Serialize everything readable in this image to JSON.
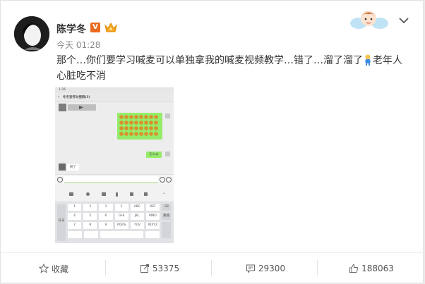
{
  "user": {
    "name": "陈学冬",
    "verified_badge": "V",
    "time": "今天 01:28"
  },
  "post": {
    "text_part1": "那个…你们要学习喊麦可以单独拿我的喊麦视频教学…错了…溜了溜了",
    "text_part2": "老年人心脏吃不消"
  },
  "screenshot": {
    "status_time": "1:26",
    "chat_title": "冬冬宣传对接群(5)",
    "msg_right": "怎么办",
    "msg_left": "刷了",
    "keys_row1": [
      "1",
      "2",
      "3",
      "1",
      "ABC",
      "DEF",
      "⌫"
    ],
    "keys_row2": [
      "4",
      "5",
      "6",
      "GHI",
      "JKL",
      "MNO"
    ],
    "keys_row3": [
      "7",
      "8",
      "9",
      "PQRS",
      "TUV",
      "WXYZ"
    ],
    "key_right2": "重输",
    "key_left": "符号"
  },
  "actions": {
    "favorite_label": "收藏",
    "repost_count": "53375",
    "comment_count": "29300",
    "like_count": "188063"
  },
  "colors": {
    "accent": "#e86b1f",
    "chat_green": "#95ec69",
    "link": "#eb7350"
  }
}
